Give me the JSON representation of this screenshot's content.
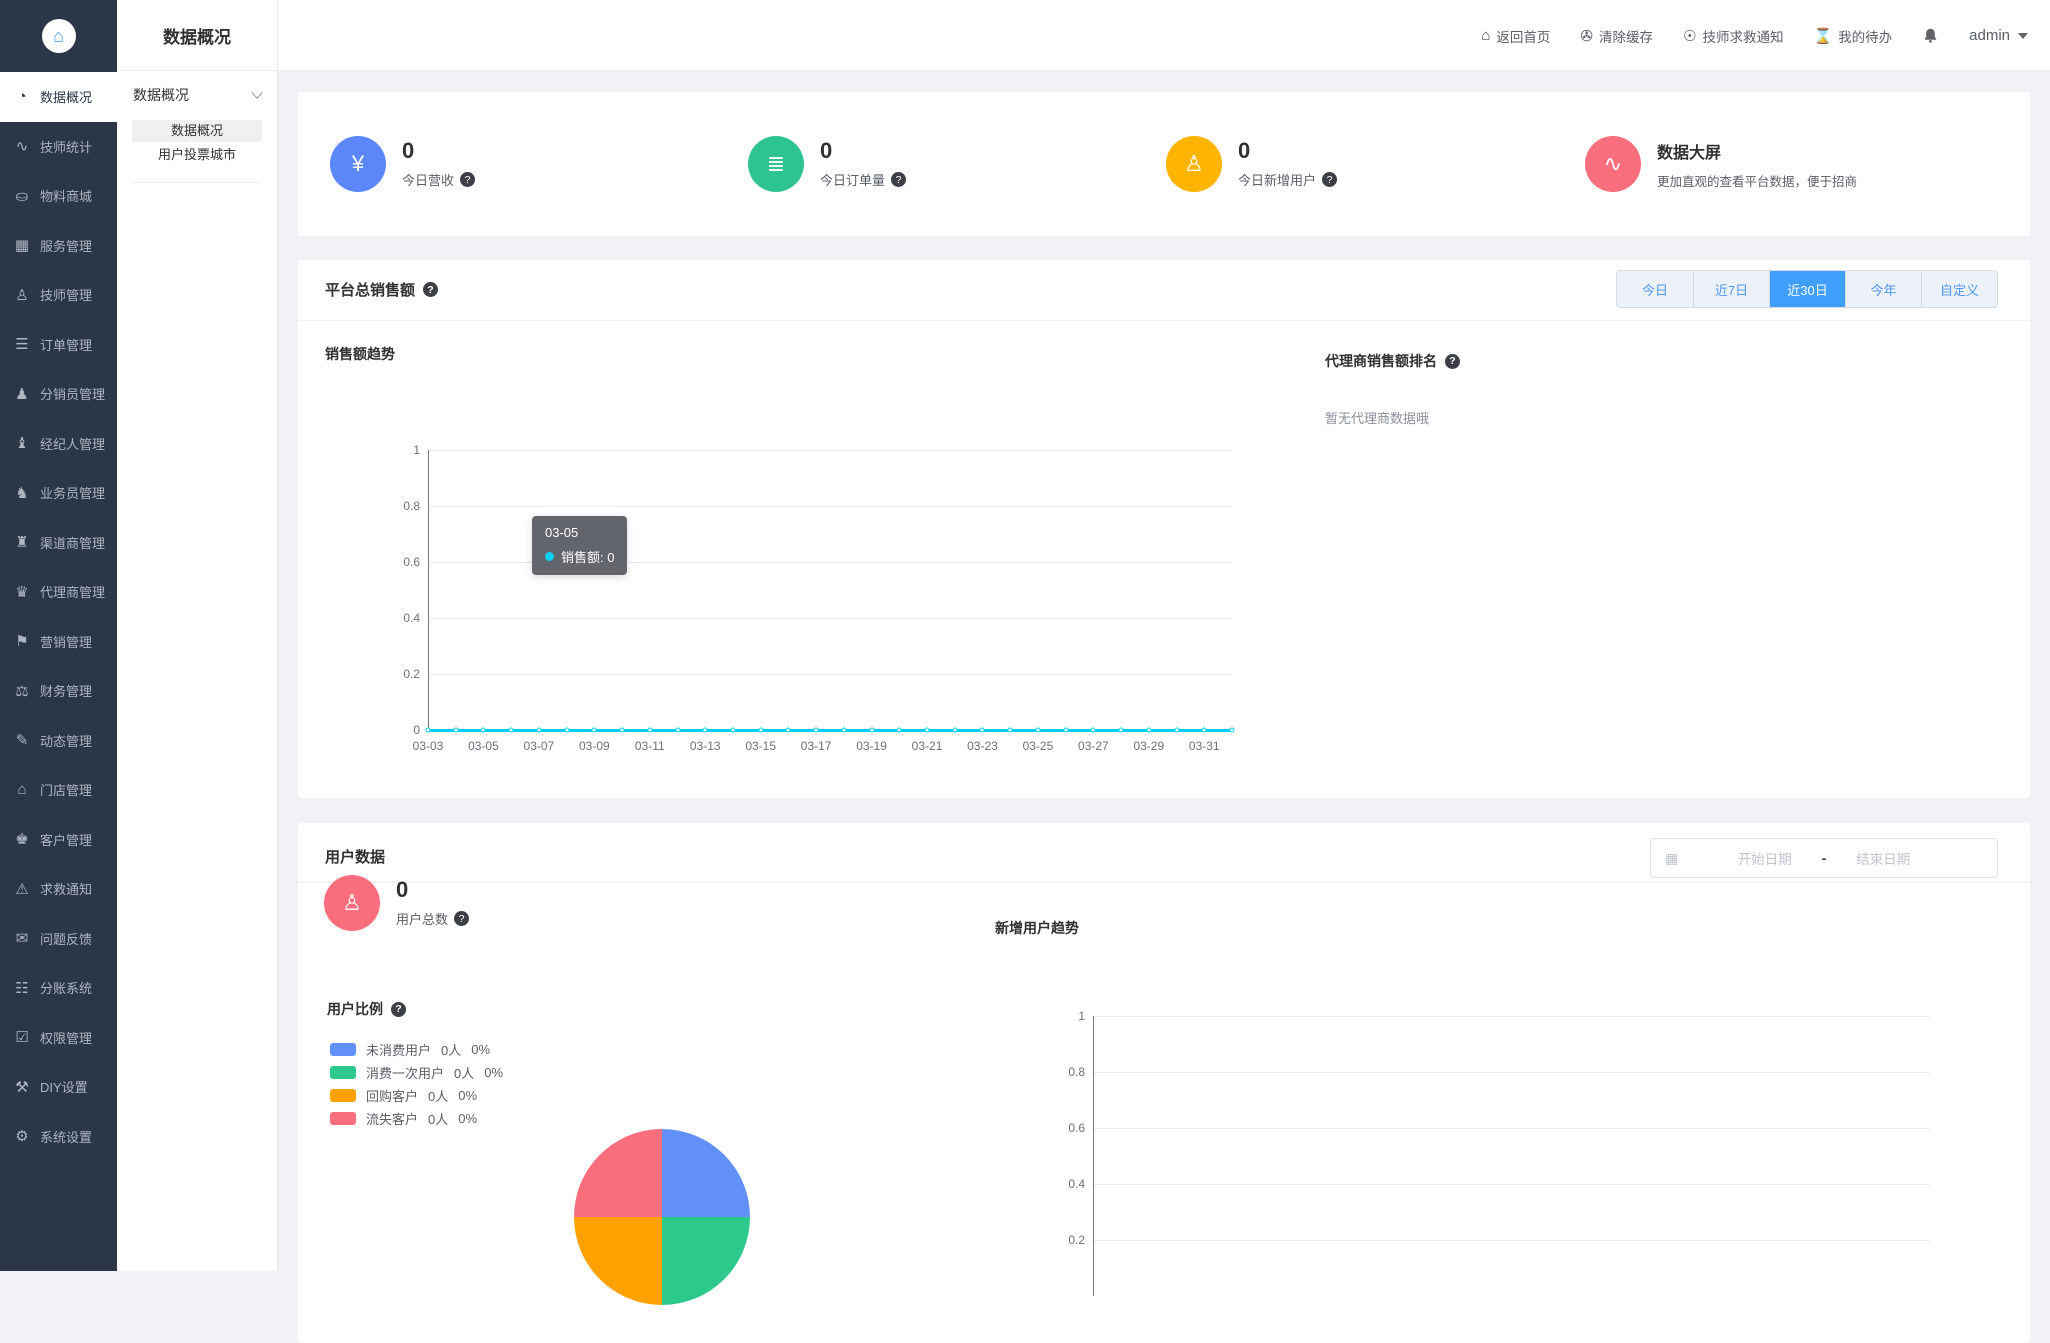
{
  "header": {
    "page_title": "数据概况",
    "nav": [
      {
        "label": "返回首页",
        "icon": "home-icon",
        "glyph": "⌂"
      },
      {
        "label": "清除缓存",
        "icon": "clear-cache-icon",
        "glyph": "✇"
      },
      {
        "label": "技师求救通知",
        "icon": "alarm-icon",
        "glyph": "☉"
      },
      {
        "label": "我的待办",
        "icon": "todo-hourglass-icon",
        "glyph": "⌛"
      }
    ],
    "user": "admin"
  },
  "icons": {
    "help": "?",
    "calendar": "▦",
    "home_logo": "⌂"
  },
  "sidebar": {
    "items": [
      {
        "label": "数据概况",
        "icon": "pie-chart-icon",
        "glyph": "◔",
        "active": true
      },
      {
        "label": "技师统计",
        "icon": "bar-chart-icon",
        "glyph": "∿"
      },
      {
        "label": "物料商城",
        "icon": "shopping-bag-icon",
        "glyph": "⛀"
      },
      {
        "label": "服务管理",
        "icon": "service-calendar-icon",
        "glyph": "▦"
      },
      {
        "label": "技师管理",
        "icon": "technician-icon",
        "glyph": "♙"
      },
      {
        "label": "订单管理",
        "icon": "order-list-icon",
        "glyph": "☰"
      },
      {
        "label": "分销员管理",
        "icon": "distributor-icon",
        "glyph": "♟"
      },
      {
        "label": "经纪人管理",
        "icon": "broker-icon",
        "glyph": "♝"
      },
      {
        "label": "业务员管理",
        "icon": "salesman-icon",
        "glyph": "♞"
      },
      {
        "label": "渠道商管理",
        "icon": "channel-icon",
        "glyph": "♜"
      },
      {
        "label": "代理商管理",
        "icon": "agent-icon",
        "glyph": "♛"
      },
      {
        "label": "营销管理",
        "icon": "marketing-icon",
        "glyph": "⚑"
      },
      {
        "label": "财务管理",
        "icon": "finance-icon",
        "glyph": "⚖"
      },
      {
        "label": "动态管理",
        "icon": "feed-icon",
        "glyph": "✎"
      },
      {
        "label": "门店管理",
        "icon": "store-icon",
        "glyph": "⌂"
      },
      {
        "label": "客户管理",
        "icon": "customer-icon",
        "glyph": "♚"
      },
      {
        "label": "求救通知",
        "icon": "sos-bell-icon",
        "glyph": "⚠"
      },
      {
        "label": "问题反馈",
        "icon": "feedback-icon",
        "glyph": "✉"
      },
      {
        "label": "分账系统",
        "icon": "ledger-icon",
        "glyph": "☷"
      },
      {
        "label": "权限管理",
        "icon": "permission-icon",
        "glyph": "☑"
      },
      {
        "label": "DIY设置",
        "icon": "diy-icon",
        "glyph": "⚒"
      },
      {
        "label": "系统设置",
        "icon": "settings-gear-icon",
        "glyph": "⚙"
      }
    ]
  },
  "submenu": {
    "group": "数据概况",
    "items": [
      {
        "label": "数据概况",
        "active": true
      },
      {
        "label": "用户投票城市",
        "active": false
      }
    ]
  },
  "stats": {
    "cards": [
      {
        "type": "stat",
        "value": "0",
        "label": "今日营收",
        "color": "#5b87f8",
        "icon": "money-bag-icon",
        "glyph": "¥"
      },
      {
        "type": "stat",
        "value": "0",
        "label": "今日订单量",
        "color": "#2ec48f",
        "icon": "clipboard-icon",
        "glyph": "≣"
      },
      {
        "type": "stat",
        "value": "0",
        "label": "今日新增用户",
        "color": "#ffb400",
        "icon": "user-icon",
        "glyph": "♙"
      },
      {
        "type": "link",
        "title": "数据大屏",
        "desc": "更加直观的查看平台数据，便于招商",
        "color": "#fa6e7e",
        "icon": "monitor-chart-icon",
        "glyph": "∿"
      }
    ]
  },
  "sales": {
    "title": "平台总销售额",
    "tabs": [
      "今日",
      "近7日",
      "近30日",
      "今年",
      "自定义"
    ],
    "active_tab": 2,
    "chart_title": "销售额趋势",
    "tooltip": {
      "date": "03-05",
      "series": "销售额",
      "value": "0"
    },
    "ranking_title": "代理商销售额排名",
    "ranking_empty": "暂无代理商数据哦"
  },
  "users": {
    "title": "用户数据",
    "date_start": "开始日期",
    "date_sep": "-",
    "date_end": "结束日期",
    "total_value": "0",
    "total_label": "用户总数",
    "total_color": "#fa6e7e",
    "ratio_title": "用户比例",
    "legend": [
      {
        "label": "未消费用户",
        "count": "0人",
        "pct": "0%",
        "color": "#6190f8"
      },
      {
        "label": "消费一次用户",
        "count": "0人",
        "pct": "0%",
        "color": "#2dc98c"
      },
      {
        "label": "回购客户",
        "count": "0人",
        "pct": "0%",
        "color": "#ffa200"
      },
      {
        "label": "流失客户",
        "count": "0人",
        "pct": "0%",
        "color": "#fa6e7e"
      }
    ],
    "trend_title": "新增用户趋势"
  },
  "chart_data": [
    {
      "id": "sales_trend",
      "type": "line",
      "title": "销售额趋势",
      "x": [
        "03-03",
        "03-04",
        "03-05",
        "03-06",
        "03-07",
        "03-08",
        "03-09",
        "03-10",
        "03-11",
        "03-12",
        "03-13",
        "03-14",
        "03-15",
        "03-16",
        "03-17",
        "03-18",
        "03-19",
        "03-20",
        "03-21",
        "03-22",
        "03-23",
        "03-24",
        "03-25",
        "03-26",
        "03-27",
        "03-28",
        "03-29",
        "03-30",
        "03-31",
        "04-01"
      ],
      "values": [
        0,
        0,
        0,
        0,
        0,
        0,
        0,
        0,
        0,
        0,
        0,
        0,
        0,
        0,
        0,
        0,
        0,
        0,
        0,
        0,
        0,
        0,
        0,
        0,
        0,
        0,
        0,
        0,
        0,
        0
      ],
      "ylim": [
        0,
        1
      ],
      "yticks": [
        0,
        0.2,
        0.4,
        0.6,
        0.8,
        1
      ],
      "x_label_every": 2,
      "line_color": "#00cff5",
      "grid": true,
      "legend_position": "none",
      "tooltip": {
        "x": "03-05",
        "series": "销售额",
        "value": 0
      }
    },
    {
      "id": "new_users_trend",
      "type": "line",
      "title": "新增用户趋势",
      "x": [],
      "values": [],
      "ylim": [
        0,
        1
      ],
      "yticks": [
        0.2,
        0.4,
        0.6,
        0.8,
        1
      ],
      "grid": true,
      "legend_position": "none"
    },
    {
      "id": "user_ratio",
      "type": "pie",
      "title": "用户比例",
      "slices": [
        {
          "label": "未消费用户",
          "count": "0人",
          "pct_label": "0%",
          "render_fraction": 0.25,
          "color": "#6190f8"
        },
        {
          "label": "消费一次用户",
          "count": "0人",
          "pct_label": "0%",
          "render_fraction": 0.25,
          "color": "#2dc98c"
        },
        {
          "label": "回购客户",
          "count": "0人",
          "pct_label": "0%",
          "render_fraction": 0.25,
          "color": "#ffa200"
        },
        {
          "label": "流失客户",
          "count": "0人",
          "pct_label": "0%",
          "render_fraction": 0.25,
          "color": "#fa6e7e"
        }
      ]
    }
  ]
}
